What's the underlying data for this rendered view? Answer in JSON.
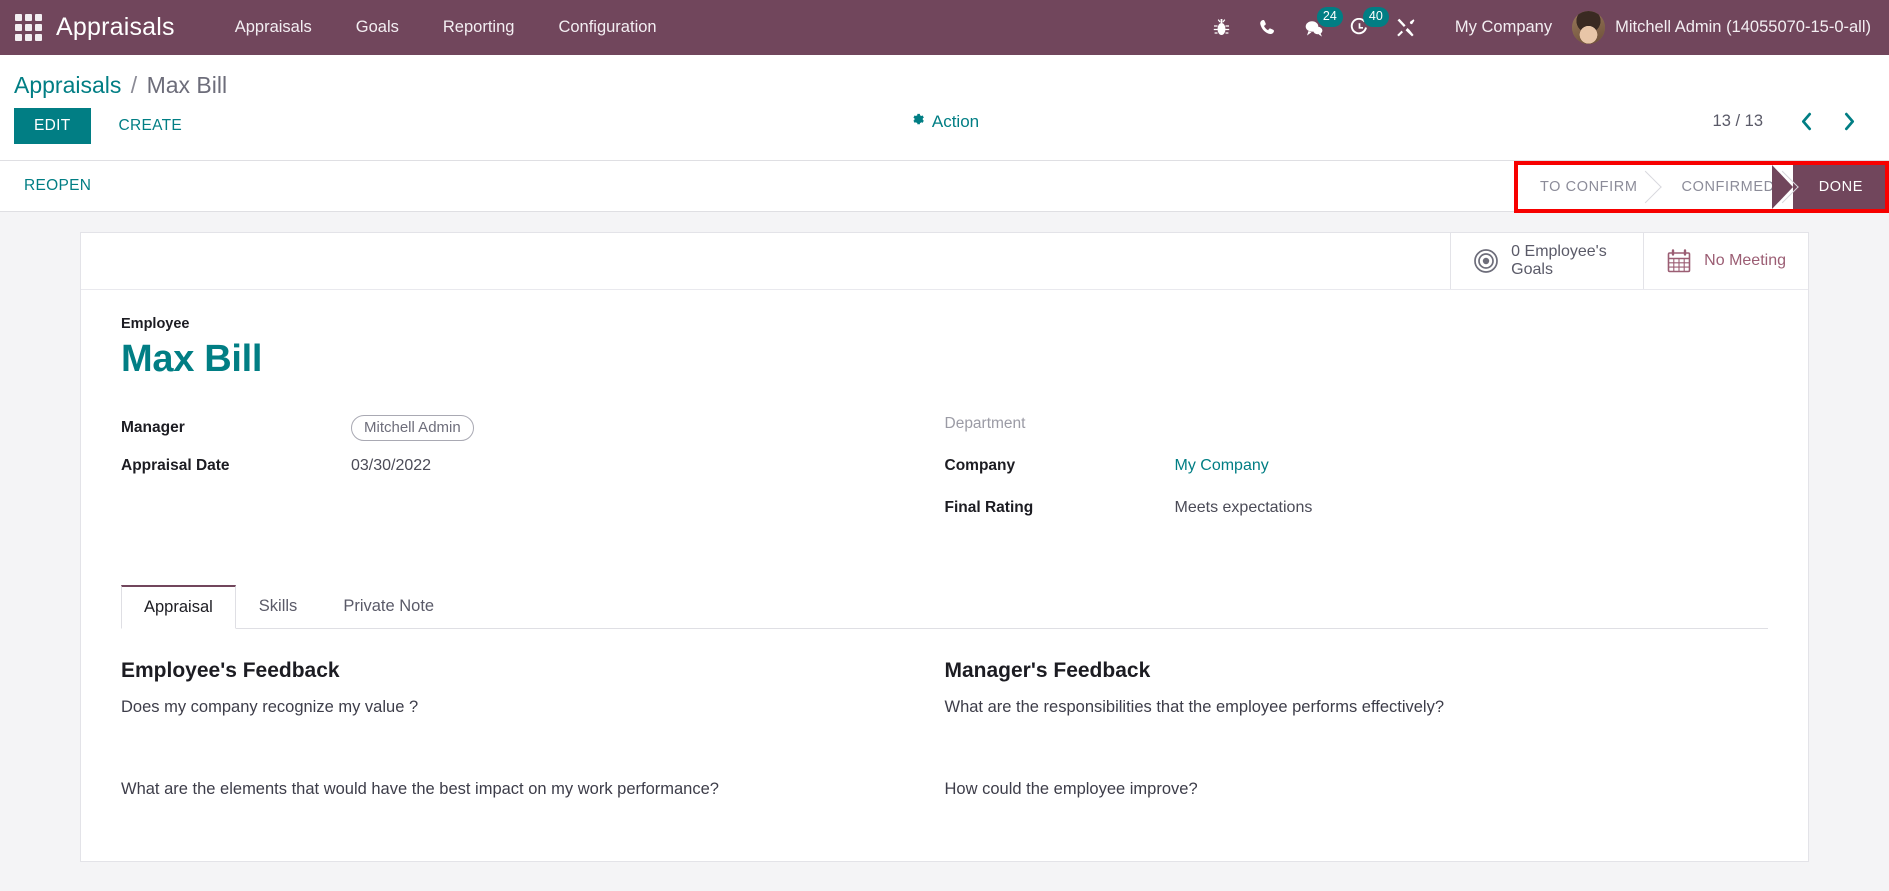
{
  "navbar": {
    "apps_icon": "apps-grid-icon",
    "brand": "Appraisals",
    "menu": [
      {
        "label": "Appraisals"
      },
      {
        "label": "Goals"
      },
      {
        "label": "Reporting"
      },
      {
        "label": "Configuration"
      }
    ],
    "systray": [
      {
        "name": "bug-icon",
        "badge": null
      },
      {
        "name": "phone-icon",
        "badge": null
      },
      {
        "name": "messages-icon",
        "badge": "24"
      },
      {
        "name": "activity-clock-icon",
        "badge": "40"
      },
      {
        "name": "tools-icon",
        "badge": null
      }
    ],
    "company": "My Company",
    "avatar": "user-avatar",
    "user": "Mitchell Admin (14055070-15-0-all)"
  },
  "control_panel": {
    "breadcrumb_root": "Appraisals",
    "breadcrumb_sep": "/",
    "breadcrumb_current": "Max Bill",
    "edit_label": "EDIT",
    "create_label": "CREATE",
    "action_label": "Action",
    "action_icon": "gear-icon",
    "pager_count": "13 / 13",
    "pager_prev_icon": "chevron-left-icon",
    "pager_next_icon": "chevron-right-icon"
  },
  "statusbar": {
    "reopen_label": "REOPEN",
    "highlight_color": "#f70000",
    "active_color": "#71465c",
    "steps": [
      {
        "label": "TO CONFIRM",
        "active": false
      },
      {
        "label": "CONFIRMED",
        "active": false
      },
      {
        "label": "DONE",
        "active": true
      }
    ]
  },
  "stat_buttons": [
    {
      "name": "employee-goals-stat",
      "icon": "bullseye-icon",
      "text": "0 Employee's Goals"
    },
    {
      "name": "meeting-stat",
      "icon": "calendar-icon",
      "text": "No Meeting"
    }
  ],
  "record": {
    "employee_label": "Employee",
    "employee_name": "Max Bill",
    "left_fields": [
      {
        "label": "Manager",
        "value": "Mitchell Admin",
        "type": "tag"
      },
      {
        "label": "Appraisal Date",
        "value": "03/30/2022",
        "type": "text"
      }
    ],
    "right_fields": [
      {
        "label": "Department",
        "value": "",
        "type": "empty"
      },
      {
        "label": "Company",
        "value": "My Company",
        "type": "link"
      },
      {
        "label": "Final Rating",
        "value": "Meets expectations",
        "type": "text"
      }
    ]
  },
  "notebook": {
    "tabs": [
      {
        "label": "Appraisal",
        "active": true
      },
      {
        "label": "Skills",
        "active": false
      },
      {
        "label": "Private Note",
        "active": false
      }
    ],
    "employee_feedback": {
      "title": "Employee's Feedback",
      "questions": [
        "Does my company recognize my value ?",
        "What are the elements that would have the best impact on my work performance?"
      ]
    },
    "manager_feedback": {
      "title": "Manager's Feedback",
      "questions": [
        "What are the responsibilities that the employee performs effectively?",
        "How could the employee improve?"
      ]
    }
  },
  "colors": {
    "brand_purple": "#71465c",
    "accent_teal": "#017e84",
    "annotation_red": "#f70000",
    "badge_teal": "#017e84"
  }
}
